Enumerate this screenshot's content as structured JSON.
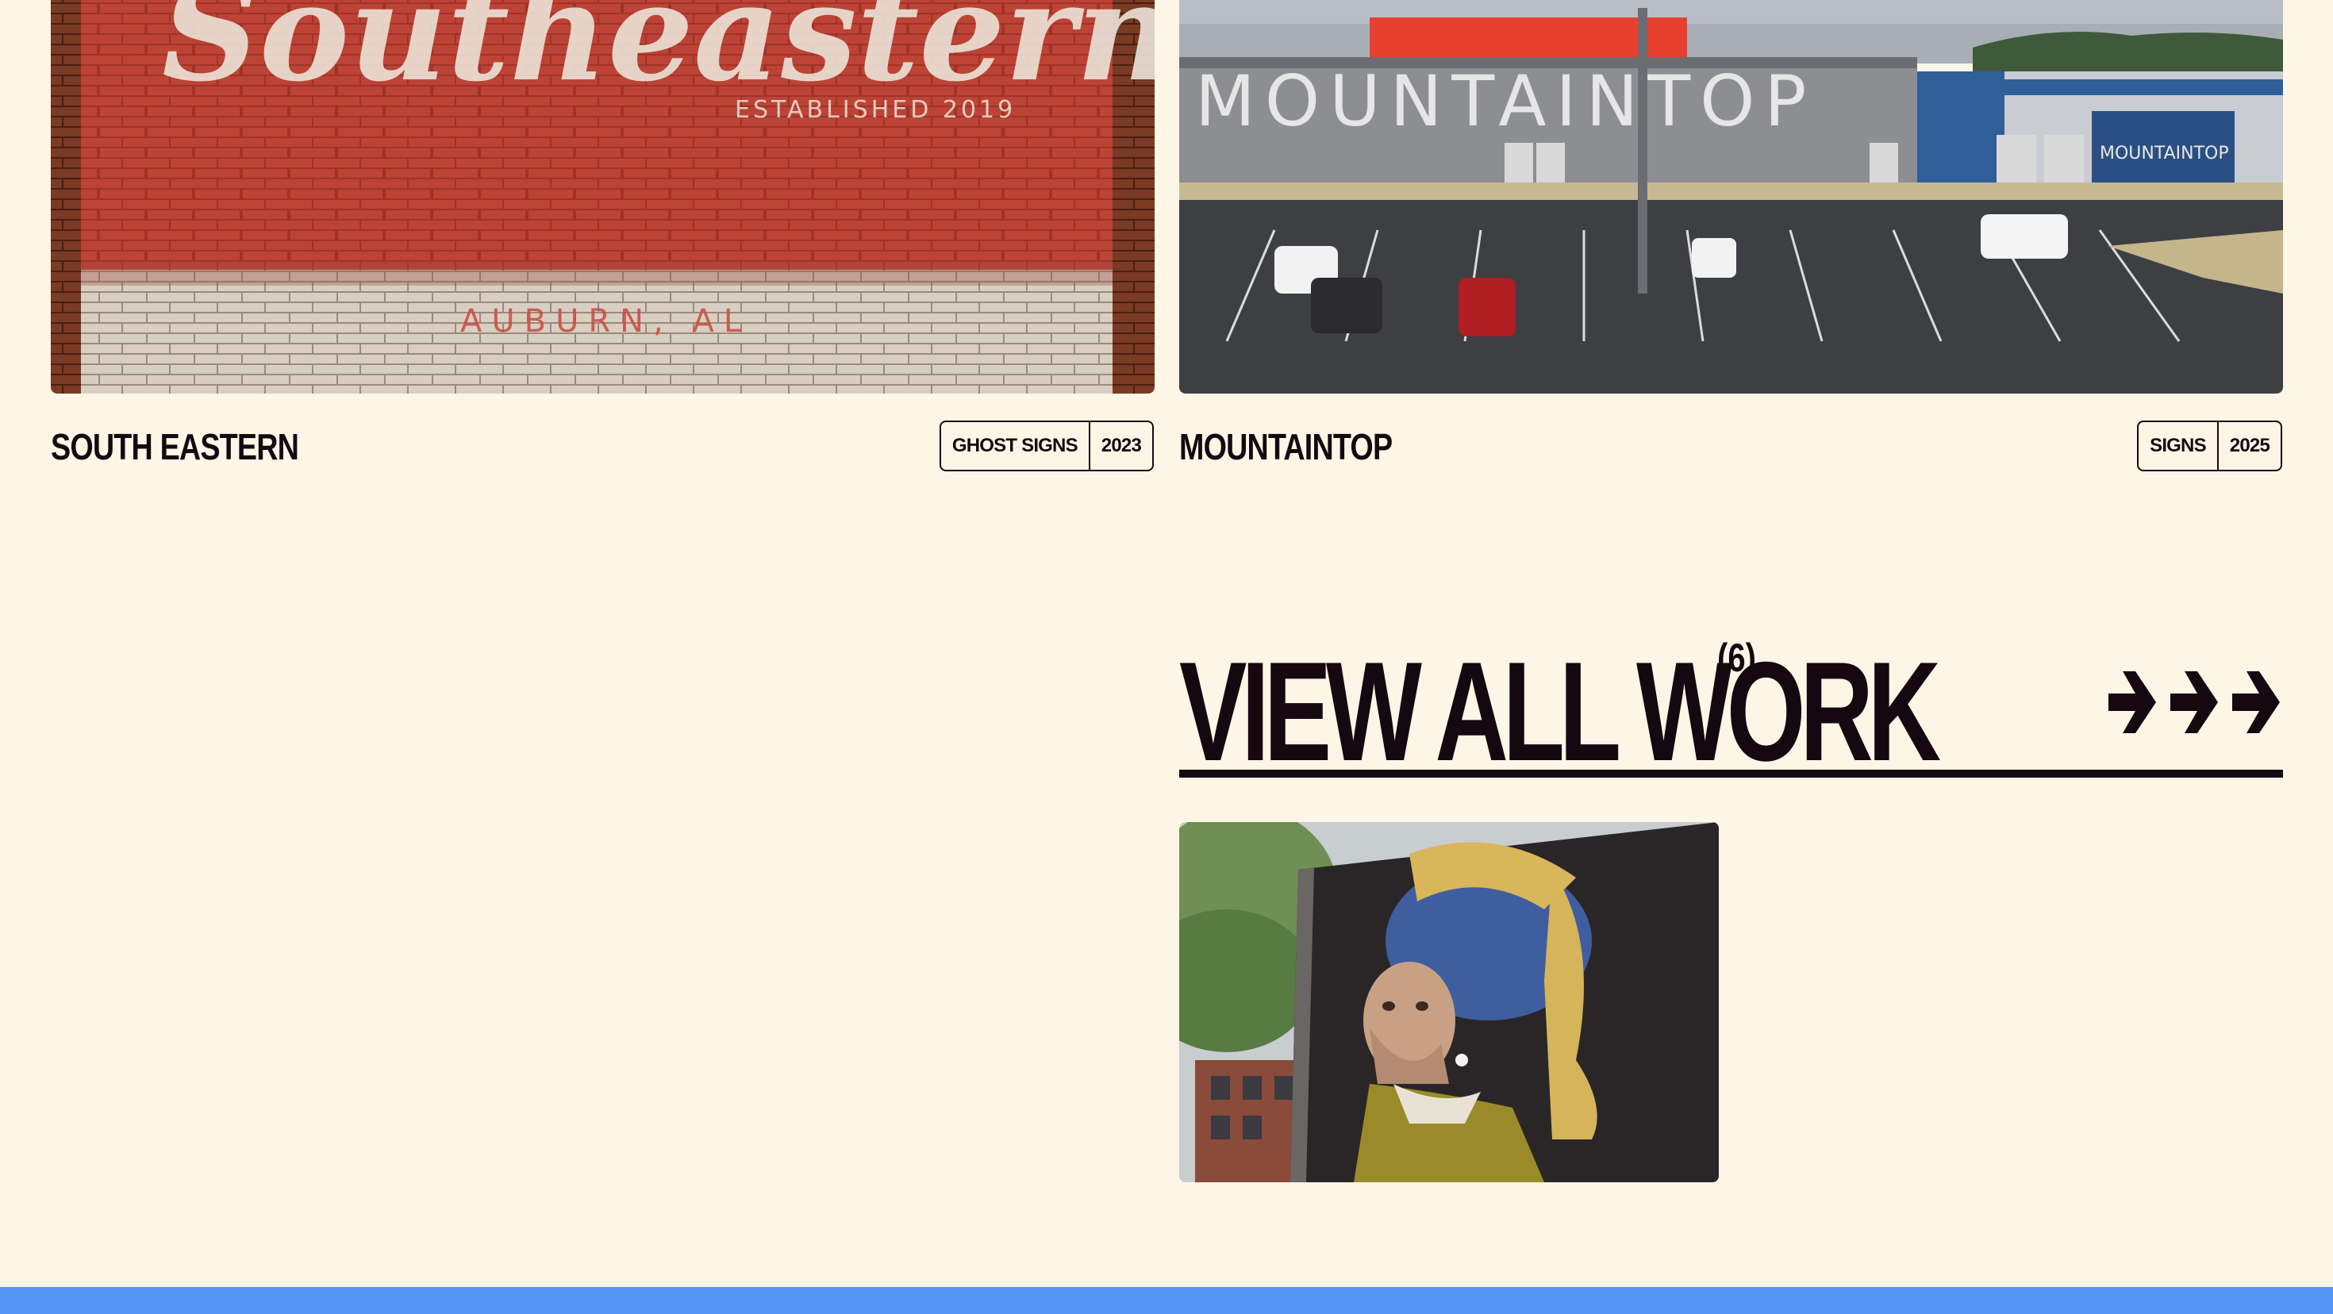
{
  "projects": [
    {
      "title": "SOUTH EASTERN",
      "tags": [
        "GHOST SIGNS",
        "2023"
      ],
      "image": {
        "sign_word": "Southeastern",
        "established": "ESTABLISHED 2019",
        "location": "AUBURN, AL"
      }
    },
    {
      "title": "MOUNTAINTOP",
      "tags": [
        "SIGNS",
        "2025"
      ],
      "image": {
        "building_sign": "MOUNTAINTOP",
        "side_sign": "MOUNTAINTOP"
      }
    }
  ],
  "view_all": {
    "label": "VIEW ALL WORK",
    "count": "(6)",
    "arrow_icons": [
      "arrow-right-icon",
      "arrow-right-icon",
      "arrow-right-icon"
    ]
  },
  "colors": {
    "background": "#fdf6e7",
    "ink": "#150810",
    "footer_bar": "#5796f7"
  }
}
